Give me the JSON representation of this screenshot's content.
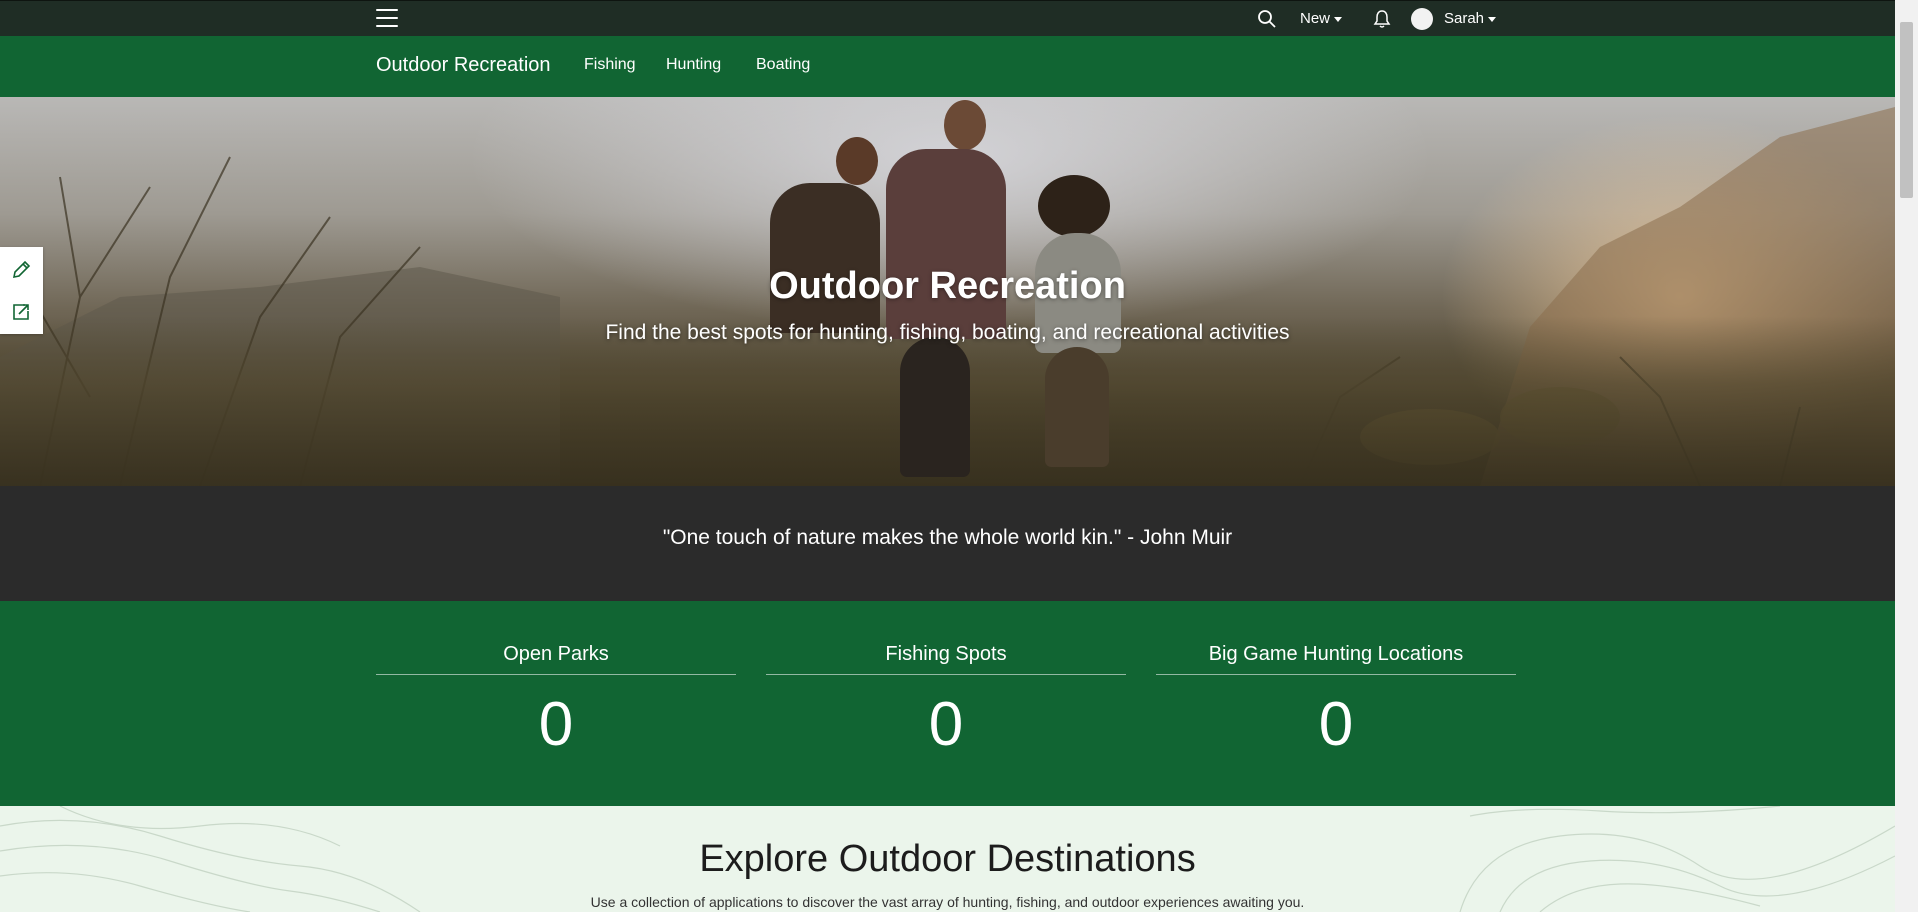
{
  "topbar": {
    "menu_icon": "hamburger-menu-icon",
    "search_icon": "search-icon",
    "new_label": "New",
    "bell_icon": "bell-icon",
    "user_name": "Sarah"
  },
  "navbar": {
    "brand": "Outdoor Recreation",
    "links": [
      "Fishing",
      "Hunting",
      "Boating"
    ]
  },
  "hero": {
    "title": "Outdoor Recreation",
    "subtitle": "Find the best spots for hunting, fishing, boating, and recreational activities"
  },
  "sidetools": {
    "edit_icon": "pencil-icon",
    "share_icon": "share-icon"
  },
  "quote": {
    "text": "\"One touch of nature makes the whole world kin.\"  -  John Muir"
  },
  "stats": [
    {
      "label": "Open Parks",
      "value": "0"
    },
    {
      "label": "Fishing Spots",
      "value": "0"
    },
    {
      "label": "Big Game Hunting Locations",
      "value": "0"
    }
  ],
  "explore": {
    "heading": "Explore Outdoor Destinations",
    "description": "Use a collection of applications to discover the vast array of hunting, fishing, and outdoor experiences awaiting you."
  },
  "colors": {
    "topbar": "#1f2d25",
    "brand_green": "#116533",
    "quote_band": "#2b2b2b",
    "explore_bg": "#ebf5eb"
  }
}
